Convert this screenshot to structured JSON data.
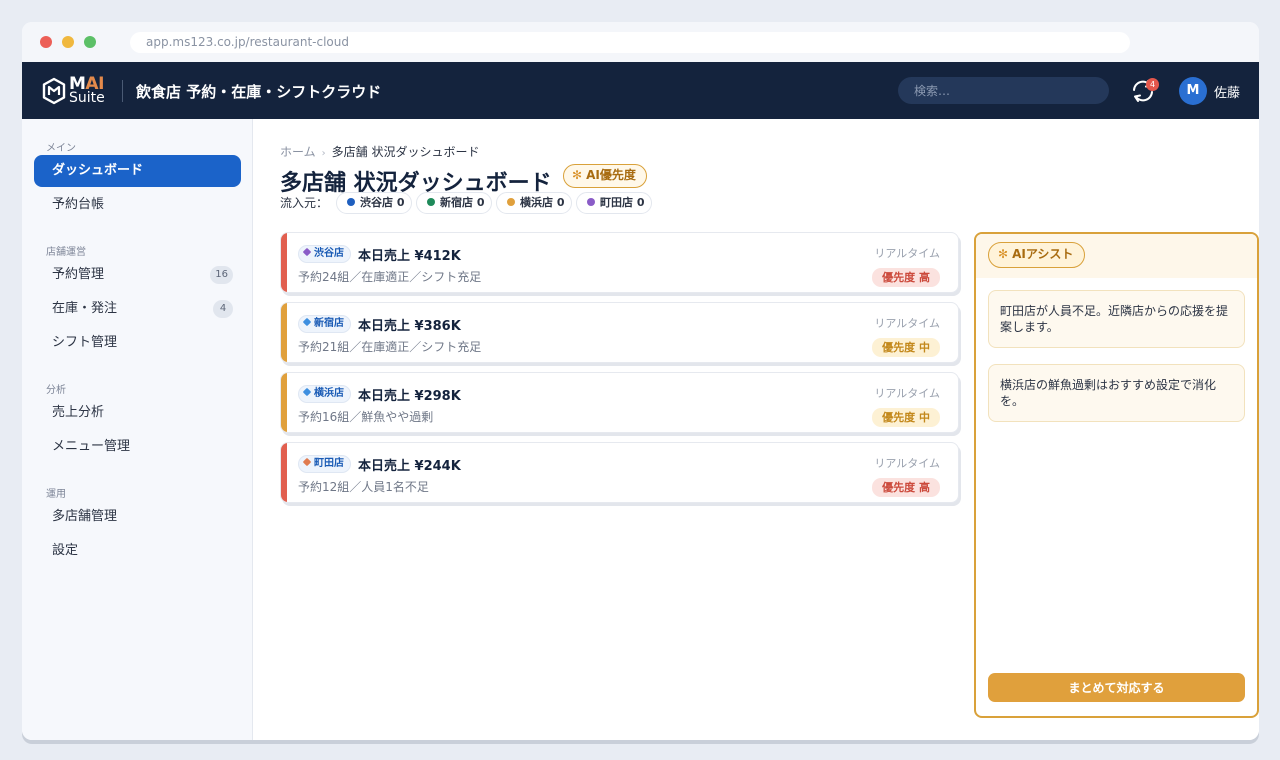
{
  "browser": {
    "url": "app.ms123.co.jp/restaurant-cloud"
  },
  "header": {
    "logo_ma": "M",
    "logo_ai": "AI",
    "logo_suite": "Suite",
    "app_title": "飲食店 予約・在庫・シフトクラウド",
    "search_placeholder": "検索…",
    "sync_badge": "4",
    "avatar_initial": "M",
    "user_name": "佐藤"
  },
  "sidebar": {
    "sections": [
      {
        "title": "メイン"
      },
      {
        "title": "店舗運営"
      },
      {
        "title": "分析"
      },
      {
        "title": "運用"
      }
    ],
    "items": [
      {
        "label": "ダッシュボード",
        "active": true
      },
      {
        "label": "予約台帳"
      },
      {
        "label": "予約管理",
        "badge": "16"
      },
      {
        "label": "在庫・発注",
        "badge": "4"
      },
      {
        "label": "シフト管理"
      },
      {
        "label": "売上分析"
      },
      {
        "label": "メニュー管理"
      },
      {
        "label": "多店舗管理"
      },
      {
        "label": "設定"
      }
    ]
  },
  "breadcrumb": {
    "home": "ホーム",
    "sep": "›",
    "current": "多店舗 状況ダッシュボード"
  },
  "page": {
    "title": "多店舗 状況ダッシュボード",
    "ai_pill": "AI優先度",
    "ai_flower": "✻",
    "source_label": "流入元："
  },
  "sources": [
    {
      "label": "渋谷店 0",
      "color": "#1f5fbf"
    },
    {
      "label": "新宿店 0",
      "color": "#1f8a5a"
    },
    {
      "label": "横浜店 0",
      "color": "#e0a03c"
    },
    {
      "label": "町田店 0",
      "color": "#8a5cc7"
    }
  ],
  "stores": [
    {
      "tag": "渋谷店",
      "tag_dot": "#8a5cc7",
      "sales": "本日売上 ¥412K",
      "detail": "予約24組／在庫適正／シフト充足",
      "realtime": "リアルタイム",
      "priority": "優先度 高",
      "stripe": "#e15f4f"
    },
    {
      "tag": "新宿店",
      "tag_dot": "#3d8fe0",
      "sales": "本日売上 ¥386K",
      "detail": "予約21組／在庫適正／シフト充足",
      "realtime": "リアルタイム",
      "priority": "優先度 中",
      "stripe": "#e0a03c"
    },
    {
      "tag": "横浜店",
      "tag_dot": "#3d8fe0",
      "sales": "本日売上 ¥298K",
      "detail": "予約16組／鮮魚やや過剰",
      "realtime": "リアルタイム",
      "priority": "優先度 中",
      "stripe": "#e0a03c"
    },
    {
      "tag": "町田店",
      "tag_dot": "#e07b4f",
      "sales": "本日売上 ¥244K",
      "detail": "予約12組／人員1名不足",
      "realtime": "リアルタイム",
      "priority": "優先度 高",
      "stripe": "#e15f4f"
    }
  ],
  "ai_panel": {
    "tag": "AIアシスト",
    "messages": [
      "町田店が人員不足。近隣店からの応援を提案します。",
      "横浜店の鮮魚過剰はおすすめ設定で消化を。"
    ],
    "button": "まとめて対応する"
  },
  "colors": {
    "brand_dark": "#14233d",
    "primary": "#1b63c9",
    "ai_accent": "#e0a03c",
    "priority_high": "#cc4a3c",
    "priority_mid": "#c3881b"
  }
}
